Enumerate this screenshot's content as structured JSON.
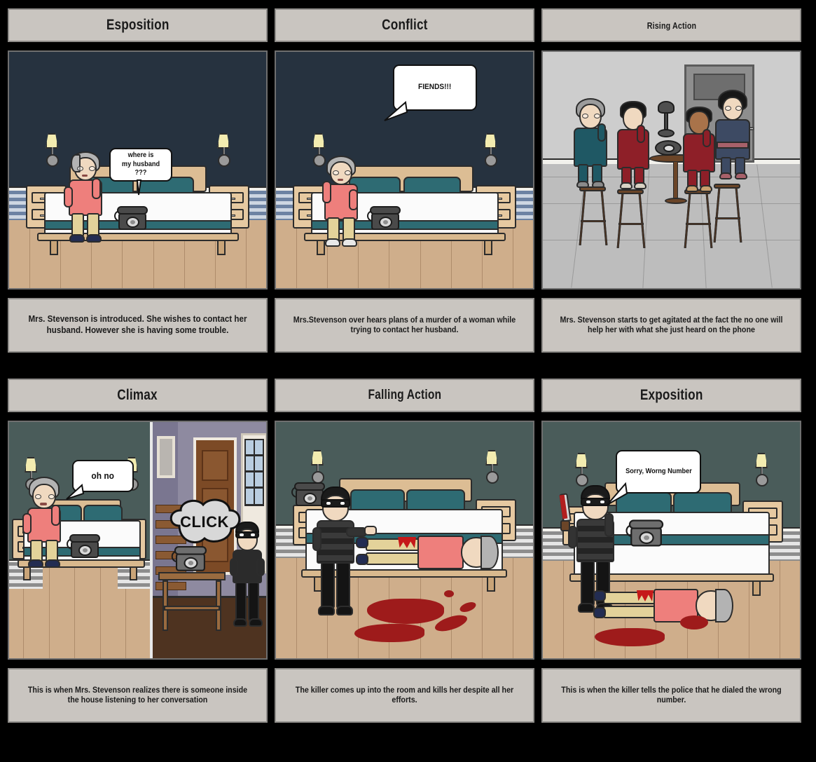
{
  "storyboard": {
    "background_color": "#000000",
    "panel_title_bg": "#c9c5c0",
    "caption_bg": "#c9c5c0",
    "cells": [
      {
        "id": "cell-1",
        "title": "Esposition",
        "title_size": "large",
        "caption": "Mrs. Stevenson is introduced. She wishes to contact her husband. However she is having some trouble.",
        "caption_size": "large",
        "scene": "bedroom-navy",
        "speech": {
          "text": "where is\nmy husband ???",
          "style": "speech",
          "font_size": 10
        }
      },
      {
        "id": "cell-2",
        "title": "Conflict",
        "title_size": "large",
        "caption": "Mrs.Stevenson over hears plans of a murder of a woman while trying to contact her husband.",
        "caption_size": "small",
        "scene": "bedroom-navy-2",
        "speech": {
          "text": "FIENDS!!!",
          "style": "speech",
          "font_size": 11
        }
      },
      {
        "id": "cell-3",
        "title": "Rising Action",
        "title_size": "small",
        "caption": "Mrs. Stevenson starts to get agitated at the fact the no one will help her with what she just heard on the phone",
        "caption_size": "small",
        "scene": "switchboard-room",
        "speech": null
      },
      {
        "id": "cell-4",
        "title": "Climax",
        "title_size": "large",
        "caption": "This is when Mrs. Stevenson realizes there is someone inside the house listening to her conversation",
        "caption_size": "small",
        "scene": "split-bedroom-hall",
        "speech": {
          "text": "oh no",
          "style": "speech",
          "font_size": 13
        },
        "speech2": {
          "text": "CLICK",
          "style": "cloud",
          "font_size": 22
        }
      },
      {
        "id": "cell-5",
        "title": "Falling Action",
        "title_size": "medium",
        "caption": "The killer comes up into the room and kills her despite all her efforts.",
        "caption_size": "small",
        "scene": "bedroom-murder-bed",
        "speech": null
      },
      {
        "id": "cell-6",
        "title": "Exposition",
        "title_size": "large",
        "caption": "This is when the killer tells the police that he dialed the wrong number.",
        "caption_size": "small",
        "scene": "bedroom-murder-floor",
        "speech": {
          "text": "Sorry, Worng Number",
          "style": "speech",
          "font_size": 10
        }
      }
    ]
  },
  "colors": {
    "wall_navy": "#26323f",
    "wall_teal": "#4a5c5a",
    "floor_wood": "#cfae8b",
    "bed_teal": "#2e6b73",
    "cardigan_pink": "#ee7f7c",
    "pants_khaki": "#e3d29a",
    "hair_grey": "#b3b3b3",
    "blood_red": "#9e1b1b",
    "grey_room": "#cdcdcd",
    "burglar_black": "#2b2b2b",
    "dress_red": "#8e1f28",
    "suit_teal": "#1f5864",
    "dress_navy": "#3d4a63"
  }
}
